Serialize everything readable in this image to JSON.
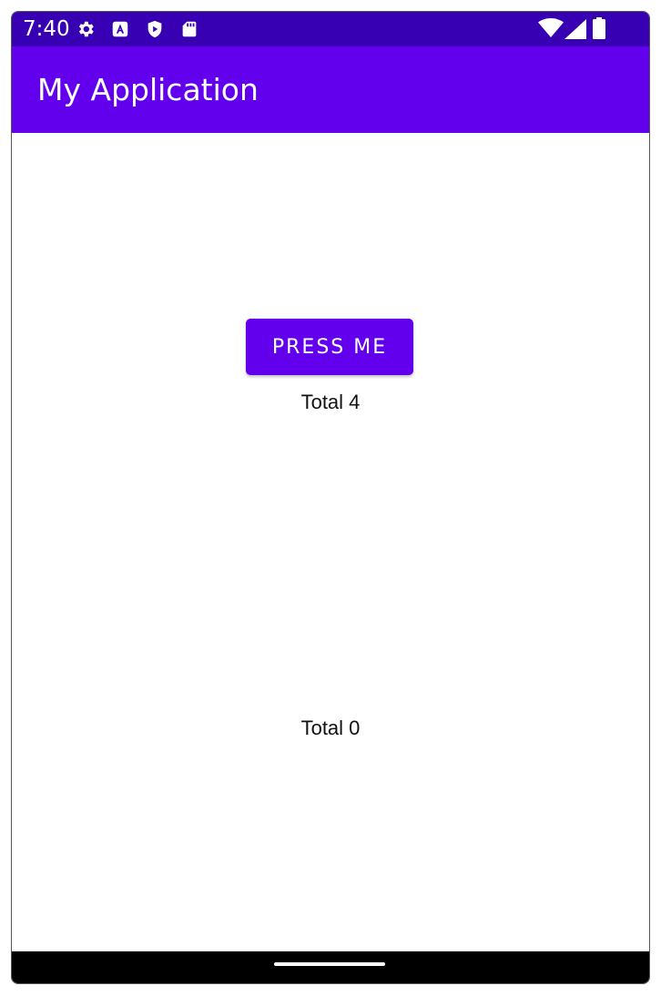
{
  "status_bar": {
    "time": "7:40",
    "left_icons": [
      "gear-icon",
      "app-store-icon",
      "shield-play-icon",
      "sd-card-icon"
    ],
    "right_icons": [
      "wifi-icon",
      "cellular-signal-icon",
      "battery-icon"
    ]
  },
  "app_bar": {
    "title": "My Application"
  },
  "main": {
    "button_label": "PRESS ME",
    "total_top": "Total 4",
    "total_bottom": "Total 0"
  },
  "colors": {
    "status_bar": "#3700b3",
    "primary": "#6200ee",
    "nav_bar": "#000000",
    "background": "#ffffff"
  }
}
